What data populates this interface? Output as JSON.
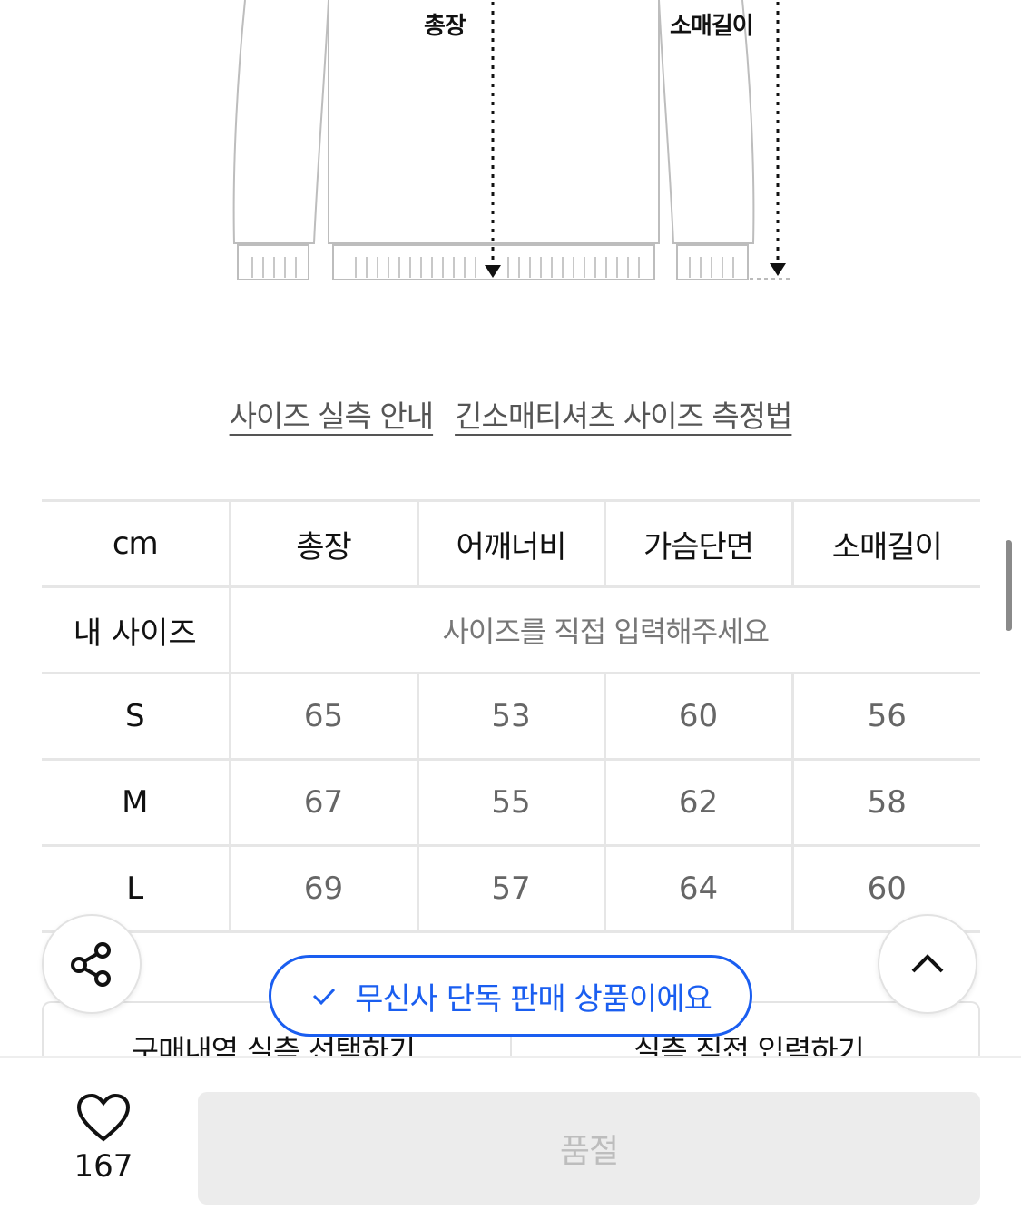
{
  "diagram": {
    "label_length": "총장",
    "label_sleeve": "소매길이"
  },
  "guide_links": {
    "actual_size_guide": "사이즈 실측 안내",
    "measure_method": "긴소매티셔츠 사이즈 측정법"
  },
  "size_table": {
    "headers": [
      "cm",
      "총장",
      "어깨너비",
      "가슴단면",
      "소매길이"
    ],
    "my_size": {
      "label": "내 사이즈",
      "input_prompt": "사이즈를 직접 입력해주세요"
    },
    "rows": [
      {
        "size": "S",
        "values": [
          "65",
          "53",
          "60",
          "56"
        ]
      },
      {
        "size": "M",
        "values": [
          "67",
          "55",
          "62",
          "58"
        ]
      },
      {
        "size": "L",
        "values": [
          "69",
          "57",
          "64",
          "60"
        ]
      }
    ]
  },
  "size_actions": {
    "purchase_history": "구매내역 실측 선택하기",
    "direct_input": "실측 직접 입력하기"
  },
  "exclusive_badge": {
    "text": "무신사 단독 판매 상품이에요",
    "icon": "check-icon",
    "color": "#1a5ef0"
  },
  "floating_buttons": {
    "share_icon": "share-icon",
    "top_icon": "chevron-up-icon"
  },
  "footer": {
    "like_icon": "heart-icon",
    "like_count": "167",
    "buy_button_label": "품절"
  }
}
